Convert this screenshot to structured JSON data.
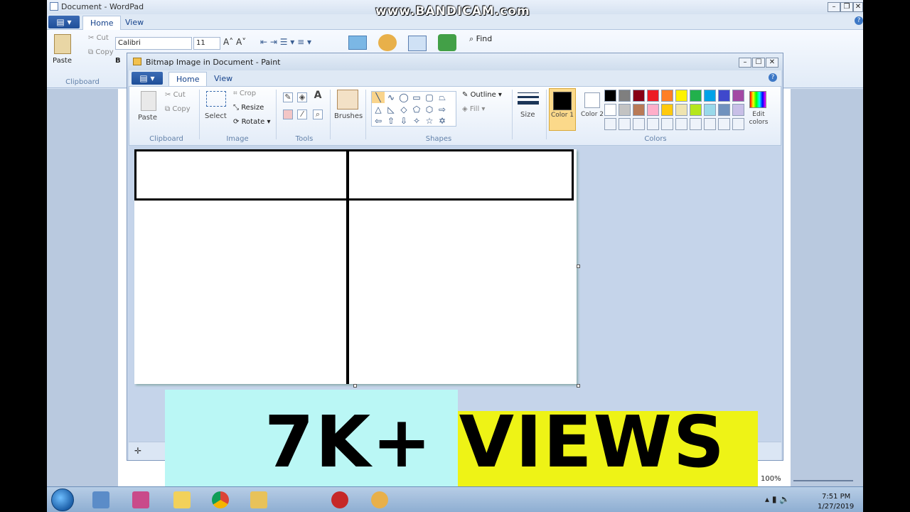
{
  "wordpad": {
    "title": "Document - WordPad",
    "tabs": [
      "Home",
      "View"
    ],
    "font_name": "Calibri",
    "font_size": "11",
    "clipboard": {
      "paste": "Paste",
      "cut": "Cut",
      "copy": "Copy",
      "group": "Clipboard"
    },
    "find": "Find",
    "zoom": "100%"
  },
  "paint": {
    "title": "Bitmap Image in Document - Paint",
    "tabs": [
      "Home",
      "View"
    ],
    "clipboard": {
      "paste": "Paste",
      "cut": "Cut",
      "copy": "Copy",
      "group": "Clipboard"
    },
    "image": {
      "select": "Select",
      "crop": "Crop",
      "resize": "Resize",
      "rotate": "Rotate",
      "group": "Image"
    },
    "tools": {
      "group": "Tools",
      "text_tool": "A"
    },
    "brushes": "Brushes",
    "shapes": {
      "outline": "Outline",
      "fill": "Fill",
      "group": "Shapes"
    },
    "size": "Size",
    "color1": "Color 1",
    "color2": "Color 2",
    "edit_colors": "Edit colors",
    "colors_group": "Colors",
    "palette_row1": [
      "#000000",
      "#7f7f7f",
      "#880015",
      "#ed1c24",
      "#ff7f27",
      "#fff200",
      "#22b14c",
      "#00a2e8",
      "#3f48cc",
      "#a349a4"
    ],
    "palette_row2": [
      "#ffffff",
      "#c3c3c3",
      "#b97a57",
      "#ffaec9",
      "#ffc90e",
      "#efe4b0",
      "#b5e61d",
      "#99d9ea",
      "#7092be",
      "#c8bfe7"
    ]
  },
  "overlay": {
    "banner": "7K+ VIEWS",
    "watermark": "www.BANDICAM.com"
  },
  "taskbar": {
    "time": "7:51 PM",
    "date": "1/27/2019"
  }
}
